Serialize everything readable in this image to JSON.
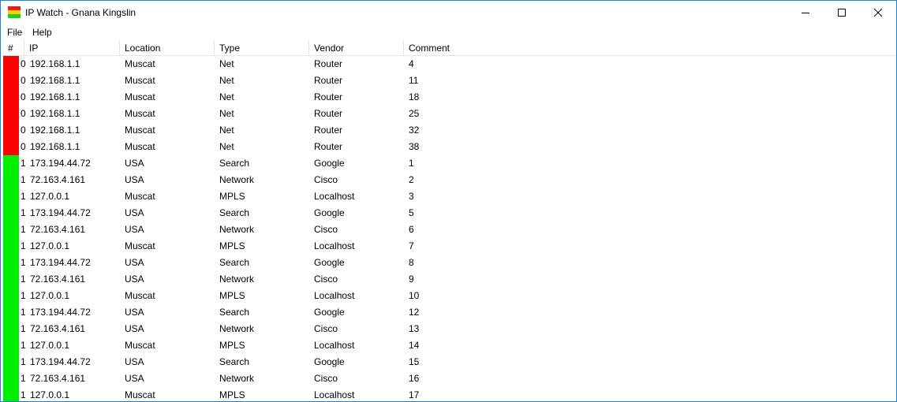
{
  "window": {
    "title": "IP Watch - Gnana Kingslin",
    "icon_colors": [
      "#e81c1c",
      "#f7d000",
      "#1fcf1f"
    ]
  },
  "menu": [
    "File",
    "Help"
  ],
  "columns": [
    "#",
    "IP",
    "Location",
    "Type",
    "Vendor",
    "Comment"
  ],
  "status_colors": {
    "0": "#ff0000",
    "1": "#00ee00"
  },
  "rows": [
    {
      "status": "0",
      "ip": "192.168.1.1",
      "location": "Muscat",
      "type": "Net",
      "vendor": "Router",
      "comment": "4"
    },
    {
      "status": "0",
      "ip": "192.168.1.1",
      "location": "Muscat",
      "type": "Net",
      "vendor": "Router",
      "comment": "11"
    },
    {
      "status": "0",
      "ip": "192.168.1.1",
      "location": "Muscat",
      "type": "Net",
      "vendor": "Router",
      "comment": "18"
    },
    {
      "status": "0",
      "ip": "192.168.1.1",
      "location": "Muscat",
      "type": "Net",
      "vendor": "Router",
      "comment": "25"
    },
    {
      "status": "0",
      "ip": "192.168.1.1",
      "location": "Muscat",
      "type": "Net",
      "vendor": "Router",
      "comment": "32"
    },
    {
      "status": "0",
      "ip": "192.168.1.1",
      "location": "Muscat",
      "type": "Net",
      "vendor": "Router",
      "comment": "38"
    },
    {
      "status": "1",
      "ip": "173.194.44.72",
      "location": "USA",
      "type": "Search",
      "vendor": "Google",
      "comment": "1"
    },
    {
      "status": "1",
      "ip": "72.163.4.161",
      "location": "USA",
      "type": "Network",
      "vendor": "Cisco",
      "comment": "2"
    },
    {
      "status": "1",
      "ip": "127.0.0.1",
      "location": "Muscat",
      "type": "MPLS",
      "vendor": "Localhost",
      "comment": "3"
    },
    {
      "status": "1",
      "ip": "173.194.44.72",
      "location": "USA",
      "type": "Search",
      "vendor": "Google",
      "comment": "5"
    },
    {
      "status": "1",
      "ip": "72.163.4.161",
      "location": "USA",
      "type": "Network",
      "vendor": "Cisco",
      "comment": "6"
    },
    {
      "status": "1",
      "ip": "127.0.0.1",
      "location": "Muscat",
      "type": "MPLS",
      "vendor": "Localhost",
      "comment": "7"
    },
    {
      "status": "1",
      "ip": "173.194.44.72",
      "location": "USA",
      "type": "Search",
      "vendor": "Google",
      "comment": "8"
    },
    {
      "status": "1",
      "ip": "72.163.4.161",
      "location": "USA",
      "type": "Network",
      "vendor": "Cisco",
      "comment": "9"
    },
    {
      "status": "1",
      "ip": "127.0.0.1",
      "location": "Muscat",
      "type": "MPLS",
      "vendor": "Localhost",
      "comment": "10"
    },
    {
      "status": "1",
      "ip": "173.194.44.72",
      "location": "USA",
      "type": "Search",
      "vendor": "Google",
      "comment": "12"
    },
    {
      "status": "1",
      "ip": "72.163.4.161",
      "location": "USA",
      "type": "Network",
      "vendor": "Cisco",
      "comment": "13"
    },
    {
      "status": "1",
      "ip": "127.0.0.1",
      "location": "Muscat",
      "type": "MPLS",
      "vendor": "Localhost",
      "comment": "14"
    },
    {
      "status": "1",
      "ip": "173.194.44.72",
      "location": "USA",
      "type": "Search",
      "vendor": "Google",
      "comment": "15"
    },
    {
      "status": "1",
      "ip": "72.163.4.161",
      "location": "USA",
      "type": "Network",
      "vendor": "Cisco",
      "comment": "16"
    },
    {
      "status": "1",
      "ip": "127.0.0.1",
      "location": "Muscat",
      "type": "MPLS",
      "vendor": "Localhost",
      "comment": "17"
    }
  ]
}
